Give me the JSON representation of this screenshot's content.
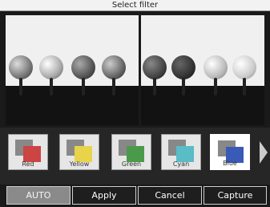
{
  "title": "Select filter",
  "filters": [
    {
      "label": "Red",
      "color": "#c44"
    },
    {
      "label": "Yellow",
      "color": "#e8d34a"
    },
    {
      "label": "Green",
      "color": "#4a9a4a"
    },
    {
      "label": "Cyan",
      "color": "#59bcc7"
    },
    {
      "label": "Blue",
      "color": "#3a5ab8"
    }
  ],
  "selected_filter": "Blue",
  "buttons": {
    "auto": "AUTO",
    "apply": "Apply",
    "cancel": "Cancel",
    "capture": "Capture"
  }
}
